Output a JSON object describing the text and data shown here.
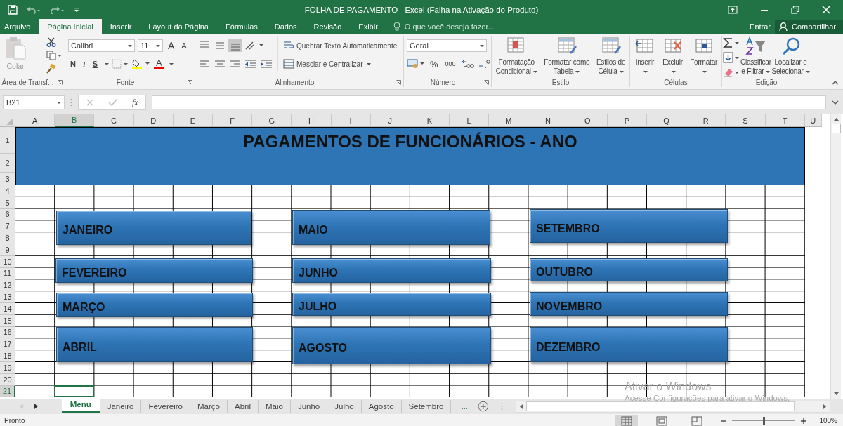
{
  "window": {
    "title": "FOLHA DE PAGAMENTO - Excel (Falha na Ativação do Produto)"
  },
  "ribbon_tabs": [
    {
      "label": "Arquivo",
      "selected": false
    },
    {
      "label": "Página Inicial",
      "selected": true
    },
    {
      "label": "Inserir",
      "selected": false
    },
    {
      "label": "Layout da Página",
      "selected": false
    },
    {
      "label": "Fórmulas",
      "selected": false
    },
    {
      "label": "Dados",
      "selected": false
    },
    {
      "label": "Revisão",
      "selected": false
    },
    {
      "label": "Exibir",
      "selected": false
    }
  ],
  "tell_me": {
    "placeholder": "O que você deseja fazer..."
  },
  "account": {
    "sign_in": "Entrar",
    "share": "Compartilhar"
  },
  "clipboard": {
    "label": "Área de Transf...",
    "paste": "Colar"
  },
  "font": {
    "label": "Fonte",
    "family": "Calibri",
    "size": "11",
    "grow": "A",
    "shrink": "A",
    "bold": "N",
    "italic": "I",
    "underline": "S",
    "text_color_button": "A"
  },
  "alignment": {
    "label": "Alinhamento",
    "wrap": "Quebrar Texto Automaticamente",
    "merge": "Mesclar e Centralizar"
  },
  "number": {
    "label": "Número",
    "format": "Geral",
    "percent": "%",
    "thousands": "000"
  },
  "styles": {
    "label": "Estilo",
    "buttons": [
      [
        "Formatação",
        "Condicional"
      ],
      [
        "Formatar como",
        "Tabela"
      ],
      [
        "Estilos de",
        "Célula"
      ]
    ]
  },
  "cells": {
    "label": "Células",
    "buttons": [
      "Inserir",
      "Excluir",
      "Formatar"
    ]
  },
  "editing": {
    "label": "Edição",
    "buttons": [
      [
        "Classificar",
        "e Filtrar"
      ],
      [
        "Localizar e",
        "Selecionar"
      ]
    ]
  },
  "formula_bar": {
    "name_box": "B21",
    "fx": "fx"
  },
  "columns": [
    {
      "label": "A",
      "selected": false
    },
    {
      "label": "B",
      "selected": true
    },
    {
      "label": "C",
      "selected": false
    },
    {
      "label": "D",
      "selected": false
    },
    {
      "label": "E",
      "selected": false
    },
    {
      "label": "F",
      "selected": false
    },
    {
      "label": "G",
      "selected": false
    },
    {
      "label": "H",
      "selected": false
    },
    {
      "label": "I",
      "selected": false
    },
    {
      "label": "J",
      "selected": false
    },
    {
      "label": "K",
      "selected": false
    },
    {
      "label": "L",
      "selected": false
    },
    {
      "label": "M",
      "selected": false
    },
    {
      "label": "N",
      "selected": false
    },
    {
      "label": "O",
      "selected": false
    },
    {
      "label": "P",
      "selected": false
    },
    {
      "label": "Q",
      "selected": false
    },
    {
      "label": "R",
      "selected": false
    },
    {
      "label": "S",
      "selected": false
    },
    {
      "label": "T",
      "selected": false
    },
    {
      "label": "U",
      "selected": false
    }
  ],
  "rows": [
    {
      "label": "1",
      "selected": false
    },
    {
      "label": "2",
      "selected": false
    },
    {
      "label": "3",
      "selected": false
    },
    {
      "label": "4",
      "selected": false
    },
    {
      "label": "5",
      "selected": false
    },
    {
      "label": "6",
      "selected": false
    },
    {
      "label": "7",
      "selected": false
    },
    {
      "label": "8",
      "selected": false
    },
    {
      "label": "9",
      "selected": false
    },
    {
      "label": "10",
      "selected": false
    },
    {
      "label": "11",
      "selected": false
    },
    {
      "label": "12",
      "selected": false
    },
    {
      "label": "13",
      "selected": false
    },
    {
      "label": "14",
      "selected": false
    },
    {
      "label": "15",
      "selected": false
    },
    {
      "label": "16",
      "selected": false
    },
    {
      "label": "17",
      "selected": false
    },
    {
      "label": "18",
      "selected": false
    },
    {
      "label": "19",
      "selected": false
    },
    {
      "label": "20",
      "selected": false
    },
    {
      "label": "21",
      "selected": true
    }
  ],
  "banner": {
    "title": "PAGAMENTOS DE FUNCIONÁRIOS - ANO"
  },
  "month_buttons": [
    {
      "label": "JANEIRO"
    },
    {
      "label": "MAIO"
    },
    {
      "label": "SETEMBRO"
    },
    {
      "label": "FEVEREIRO"
    },
    {
      "label": "JUNHO"
    },
    {
      "label": "OUTUBRO"
    },
    {
      "label": "MARÇO"
    },
    {
      "label": "JULHO"
    },
    {
      "label": "NOVEMBRO"
    },
    {
      "label": "ABRIL"
    },
    {
      "label": "AGOSTO"
    },
    {
      "label": "DEZEMBRO"
    }
  ],
  "sheet_tabs": [
    {
      "label": "Menu",
      "selected": true
    },
    {
      "label": "Janeiro",
      "selected": false
    },
    {
      "label": "Fevereiro",
      "selected": false
    },
    {
      "label": "Março",
      "selected": false
    },
    {
      "label": "Abril",
      "selected": false
    },
    {
      "label": "Maio",
      "selected": false
    },
    {
      "label": "Junho",
      "selected": false
    },
    {
      "label": "Julho",
      "selected": false
    },
    {
      "label": "Agosto",
      "selected": false
    },
    {
      "label": "Setembro",
      "selected": false
    }
  ],
  "more_sheets": "...",
  "activation_notice": {
    "title": "Ativar o Windows",
    "text": "Acesse Configurações para ativar o Windows."
  },
  "status_bar": {
    "status": "Pronto",
    "zoom": "100%",
    "zoom_slider": {
      "level": 0.5
    }
  }
}
